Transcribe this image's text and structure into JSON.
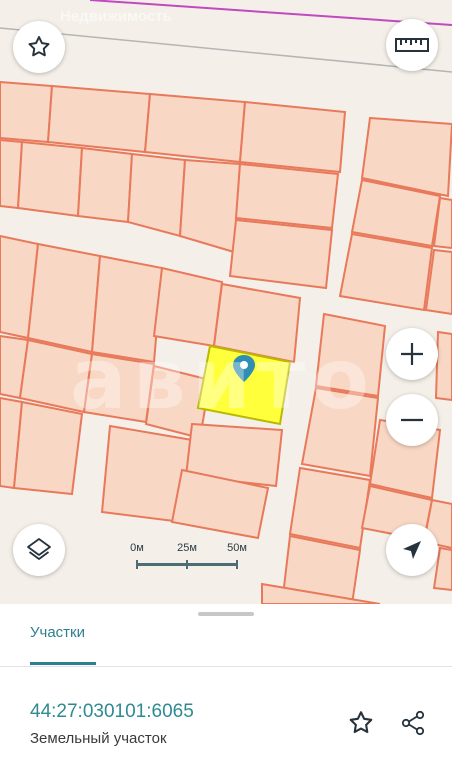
{
  "map": {
    "source_label": "Недвижимость",
    "watermark": "авито",
    "colors": {
      "background": "#f4efe8",
      "parcel_fill": "#f8d7c4",
      "parcel_stroke": "#e8795a",
      "selected_fill": "#ffff3c",
      "selected_stroke": "#c8c800",
      "marker": "#2f8fb3"
    },
    "buttons": {
      "favorite": "star-icon",
      "ruler": "ruler-icon",
      "zoom_in": "plus-icon",
      "zoom_out": "minus-icon",
      "layers": "layers-icon",
      "locate": "navigation-arrow-icon"
    },
    "scale": {
      "labels": [
        "0м",
        "25м",
        "50м"
      ]
    }
  },
  "sheet": {
    "tab_label": "Участки",
    "parcel_id": "44:27:030101:6065",
    "parcel_type": "Земельный участок",
    "actions": [
      "star-icon",
      "share-icon"
    ]
  }
}
